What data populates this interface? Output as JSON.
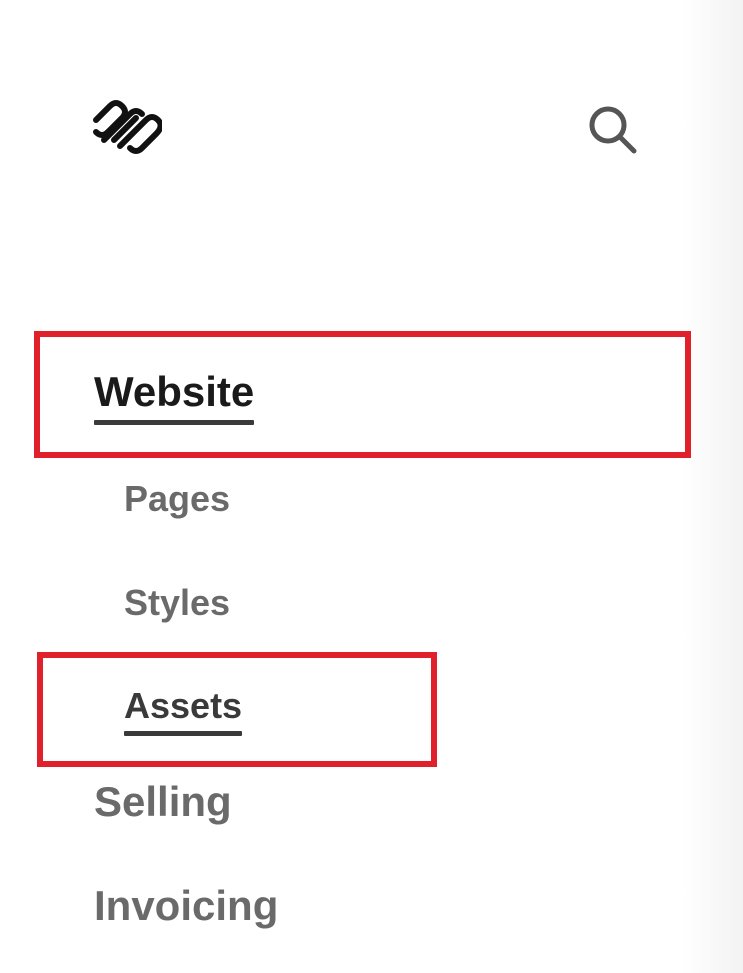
{
  "app": {
    "logo_icon": "squarespace-logo-icon",
    "search_icon": "search-icon"
  },
  "nav": {
    "website": "Website",
    "pages": "Pages",
    "styles": "Styles",
    "assets": "Assets",
    "selling": "Selling",
    "invoicing": "Invoicing"
  },
  "colors": {
    "highlight": "#e0202a",
    "active_text": "#1a1a1a",
    "inactive_text": "#6a6a6a"
  }
}
